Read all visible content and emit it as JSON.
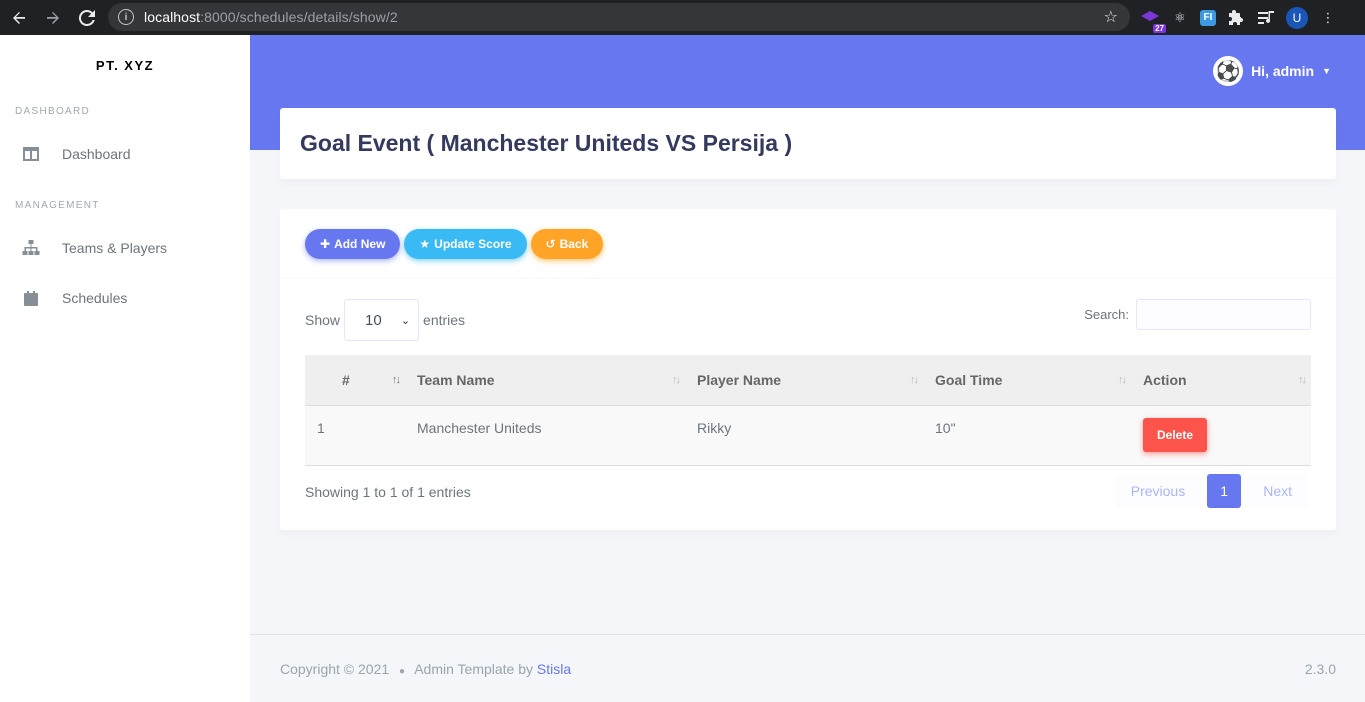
{
  "browser": {
    "url_host": "localhost",
    "url_path": ":8000/schedules/details/show/2",
    "ext_badge": "27",
    "ext_fi": "FI",
    "user_initial": "U"
  },
  "sidebar": {
    "brand": "PT. XYZ",
    "header_dashboard": "DASHBOARD",
    "header_management": "MANAGEMENT",
    "items": [
      {
        "label": "Dashboard",
        "icon": "columns-icon"
      },
      {
        "label": "Teams & Players",
        "icon": "sitemap-icon"
      },
      {
        "label": "Schedules",
        "icon": "calendar-icon"
      }
    ]
  },
  "navbar": {
    "greeting": "Hi, admin"
  },
  "page": {
    "title": "Goal Event ( Manchester Uniteds VS Persija )",
    "buttons": {
      "add_new": "Add New",
      "update_score": "Update Score",
      "back": "Back"
    }
  },
  "datatable": {
    "show_label": "Show",
    "entries_label": "entries",
    "length_value": "10",
    "search_label": "Search:",
    "search_value": "",
    "columns": [
      "#",
      "Team Name",
      "Player Name",
      "Goal Time",
      "Action"
    ],
    "rows": [
      {
        "no": "1",
        "team": "Manchester Uniteds",
        "player": "Rikky",
        "time": "10\"",
        "action": "Delete"
      }
    ],
    "info": "Showing 1 to 1 of 1 entries",
    "pagination": {
      "previous": "Previous",
      "current": "1",
      "next": "Next"
    }
  },
  "footer": {
    "copyright": "Copyright © 2021",
    "template_text": "Admin Template by",
    "template_link": "Stisla",
    "version": "2.3.0"
  },
  "colors": {
    "primary": "#6777ef",
    "info": "#3abaf4",
    "warning": "#ffa426",
    "danger": "#fc544b"
  }
}
